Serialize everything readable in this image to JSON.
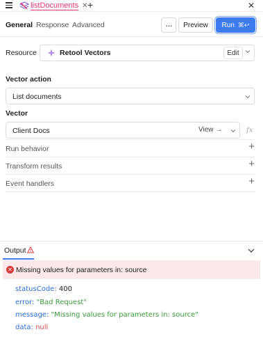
{
  "tabbar": {
    "query_name": "listDocuments",
    "close_glyph": "✕",
    "new_tab_glyph": "+",
    "panel_close_glyph": "✕"
  },
  "subheader": {
    "tabs": [
      {
        "label": "General",
        "active": true
      },
      {
        "label": "Response",
        "active": false
      },
      {
        "label": "Advanced",
        "active": false
      }
    ],
    "more_glyph": "···",
    "preview_label": "Preview",
    "run_label": "Run",
    "run_shortcut": "⌘↩"
  },
  "resource": {
    "label": "Resource",
    "name": "Retool Vectors",
    "edit_label": "Edit"
  },
  "vector_action": {
    "label": "Vector action",
    "value": "List documents"
  },
  "vector": {
    "label": "Vector",
    "value": "Client Docs",
    "view_label": "View →",
    "fx_label": "fx"
  },
  "sections": [
    {
      "label": "Run behavior",
      "icon": "plus-icon"
    },
    {
      "label": "Transform results",
      "icon": "plus-icon"
    },
    {
      "label": "Event handlers",
      "icon": "plus-icon"
    }
  ],
  "output": {
    "label": "Output",
    "error_message": "Missing values for parameters in: source",
    "result": [
      {
        "key": "statusCode:",
        "value": "400"
      },
      {
        "key": "error:",
        "value": "\"Bad Request\""
      },
      {
        "key": "message:",
        "value": "\"Missing values for parameters in: source\""
      },
      {
        "key": "data:",
        "value": "null"
      }
    ]
  },
  "colors": {
    "accent": "#3c7bf0",
    "query_name": "#e8356d",
    "error_bg": "#fbe9e9",
    "error_icon": "#d93b3b",
    "json_key": "#2b6fd6",
    "json_string": "#3a9a3a",
    "json_null": "#d9534f"
  }
}
